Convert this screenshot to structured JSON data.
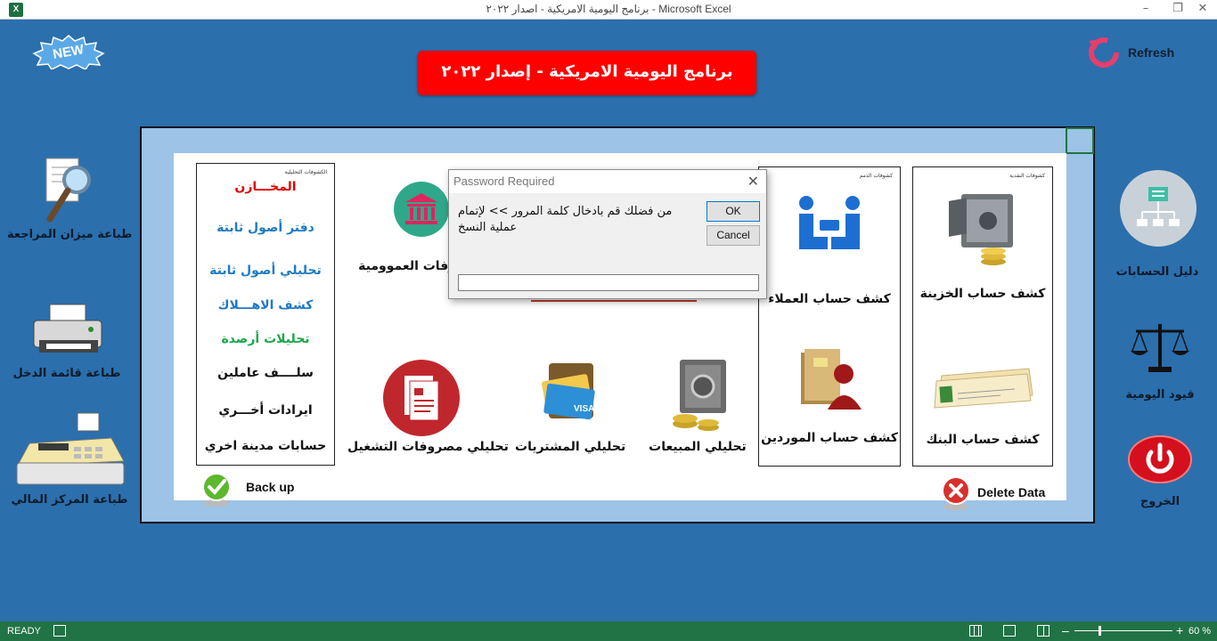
{
  "window": {
    "title": "برنامج اليومية الامريكية - اصدار ٢٠٢٢ - Microsoft Excel",
    "app_icon": "X"
  },
  "banner": {
    "text": "برنامج اليومية الامريكية - إصدار ٢٠٢٢",
    "color": "#ff0000"
  },
  "badge": {
    "text": "NEW"
  },
  "refresh": {
    "label": "Refresh"
  },
  "left_actions": [
    {
      "label": "طباعة ميزان المراجعة",
      "icon": "magnifier-document-icon"
    },
    {
      "label": "طباعة قائمة الدخل",
      "icon": "printer-icon"
    },
    {
      "label": "طباعة المركز المالي",
      "icon": "cash-register-icon"
    }
  ],
  "right_actions": [
    {
      "label": "دليل الحسابات",
      "icon": "org-chart-icon"
    },
    {
      "label": "قيود اليومية",
      "icon": "scales-icon"
    },
    {
      "label": "الخروج",
      "icon": "power-icon"
    }
  ],
  "analysis_box": {
    "header": "الكشوفات التحليلية",
    "links": [
      {
        "label": "المخـــازن",
        "color": "#e00000"
      },
      {
        "label": "دفتر أصول ثابتة",
        "color": "#1f7ac4"
      },
      {
        "label": "تحليلي أصول ثابتة",
        "color": "#1f7ac4"
      },
      {
        "label": "كشف الاهـــلاك",
        "color": "#1f7ac4"
      },
      {
        "label": "تحليلات أرصدة",
        "color": "#1aa84a"
      },
      {
        "label": "سلــــف عاملين",
        "color": "#111111"
      },
      {
        "label": "ايرادات أخـــري",
        "color": "#111111"
      },
      {
        "label": "حسابات مدينة اخري",
        "color": "#111111"
      }
    ]
  },
  "middle_items": {
    "general_expenses": "روفات العموومية",
    "operating_expenses": "تحليلي مصروفات التشغيل",
    "purchases": "تحليلي المشتريات",
    "sales": "تحليلي المبيعات"
  },
  "receivables_box": {
    "header": "كشوفات الذمم",
    "customers": "كشف حساب العملاء",
    "suppliers": "كشف حساب الموردين"
  },
  "cash_box": {
    "header": "كشوفات النقدية",
    "treasury": "كشف حساب الخزينة",
    "bank": "كشف حساب البنك"
  },
  "backup": {
    "label": "Back up"
  },
  "delete": {
    "label": "Delete Data"
  },
  "dialog": {
    "title": "Password Required",
    "prompt": "من فضلك قم بادخال كلمة المرور >> لإتمام عملية النسخ",
    "ok": "OK",
    "cancel": "Cancel",
    "value": ""
  },
  "status": {
    "mode": "READY",
    "zoom": "60 %",
    "zoom_level": 0.6
  }
}
